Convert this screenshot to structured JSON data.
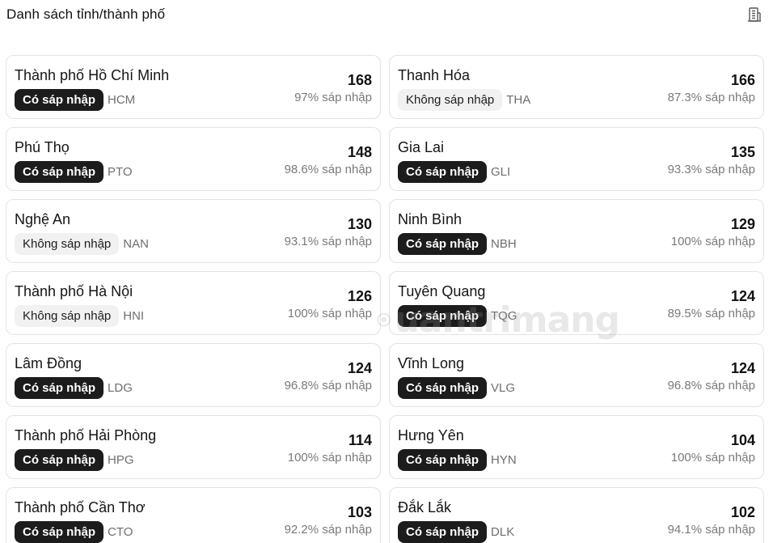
{
  "header": {
    "title": "Danh sách tỉnh/thành phố",
    "icon": "building-icon"
  },
  "cards": [
    {
      "name": "Thành phố Hồ Chí Minh",
      "status": "Có sáp nhập",
      "merged": true,
      "code": "HCM",
      "count": "168",
      "percent": "97% sáp nhập"
    },
    {
      "name": "Thanh Hóa",
      "status": "Không sáp nhập",
      "merged": false,
      "code": "THA",
      "count": "166",
      "percent": "87.3% sáp nhập"
    },
    {
      "name": "Phú Thọ",
      "status": "Có sáp nhập",
      "merged": true,
      "code": "PTO",
      "count": "148",
      "percent": "98.6% sáp nhập"
    },
    {
      "name": "Gia Lai",
      "status": "Có sáp nhập",
      "merged": true,
      "code": "GLI",
      "count": "135",
      "percent": "93.3% sáp nhập"
    },
    {
      "name": "Nghệ An",
      "status": "Không sáp nhập",
      "merged": false,
      "code": "NAN",
      "count": "130",
      "percent": "93.1% sáp nhập"
    },
    {
      "name": "Ninh Bình",
      "status": "Có sáp nhập",
      "merged": true,
      "code": "NBH",
      "count": "129",
      "percent": "100% sáp nhập"
    },
    {
      "name": "Thành phố Hà Nội",
      "status": "Không sáp nhập",
      "merged": false,
      "code": "HNI",
      "count": "126",
      "percent": "100% sáp nhập"
    },
    {
      "name": "Tuyên Quang",
      "status": "Có sáp nhập",
      "merged": true,
      "code": "TQG",
      "count": "124",
      "percent": "89.5% sáp nhập"
    },
    {
      "name": "Lâm Đồng",
      "status": "Có sáp nhập",
      "merged": true,
      "code": "LDG",
      "count": "124",
      "percent": "96.8% sáp nhập"
    },
    {
      "name": "Vĩnh Long",
      "status": "Có sáp nhập",
      "merged": true,
      "code": "VLG",
      "count": "124",
      "percent": "96.8% sáp nhập"
    },
    {
      "name": "Thành phố Hải Phòng",
      "status": "Có sáp nhập",
      "merged": true,
      "code": "HPG",
      "count": "114",
      "percent": "100% sáp nhập"
    },
    {
      "name": "Hưng Yên",
      "status": "Có sáp nhập",
      "merged": true,
      "code": "HYN",
      "count": "104",
      "percent": "100% sáp nhập"
    },
    {
      "name": "Thành phố Cần Thơ",
      "status": "Có sáp nhập",
      "merged": true,
      "code": "CTO",
      "count": "103",
      "percent": "92.2% sáp nhập"
    },
    {
      "name": "Đắk Lắk",
      "status": "Có sáp nhập",
      "merged": true,
      "code": "DLK",
      "count": "102",
      "percent": "94.1% sáp nhập"
    }
  ],
  "watermark": {
    "text": "uantrimang"
  }
}
